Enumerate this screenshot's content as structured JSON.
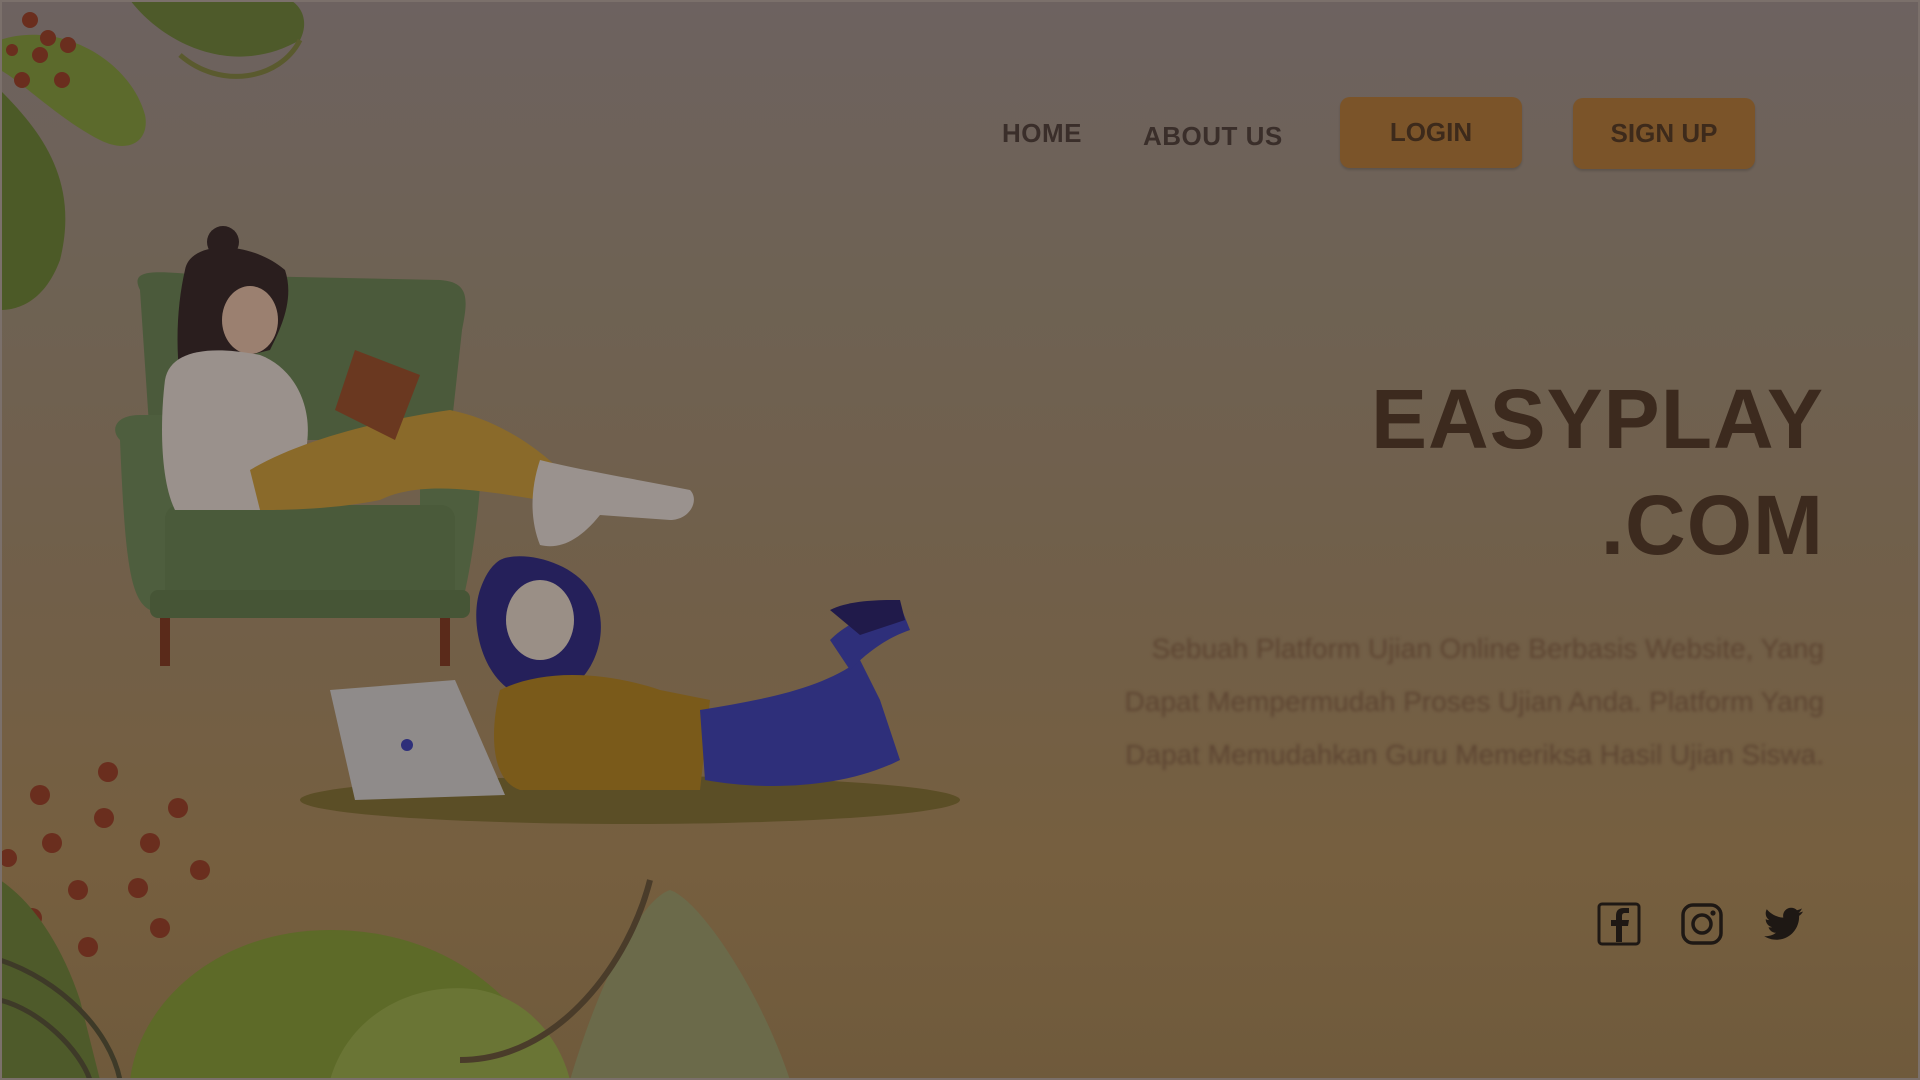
{
  "nav": {
    "home_label": "HOME",
    "about_label": "ABOUT US",
    "login_label": "LOGIN",
    "signup_label": "SIGN UP"
  },
  "hero": {
    "title_line1": "EASYPLAY",
    "title_line2": ".COM",
    "description": "Sebuah Platform Ujian Online Berbasis Website, Yang Dapat Mempermudah Proses Ujian Anda.  Platform Yang Dapat Memudahkan Guru Memeriksa Hasil Ujian Siswa."
  },
  "social": {
    "icons": [
      "facebook-icon",
      "instagram-icon",
      "twitter-icon"
    ]
  },
  "colors": {
    "button": "#7b5429",
    "title": "#3c2a1e",
    "background_top": "#6d6260",
    "background_bottom": "#6f5a3c"
  }
}
